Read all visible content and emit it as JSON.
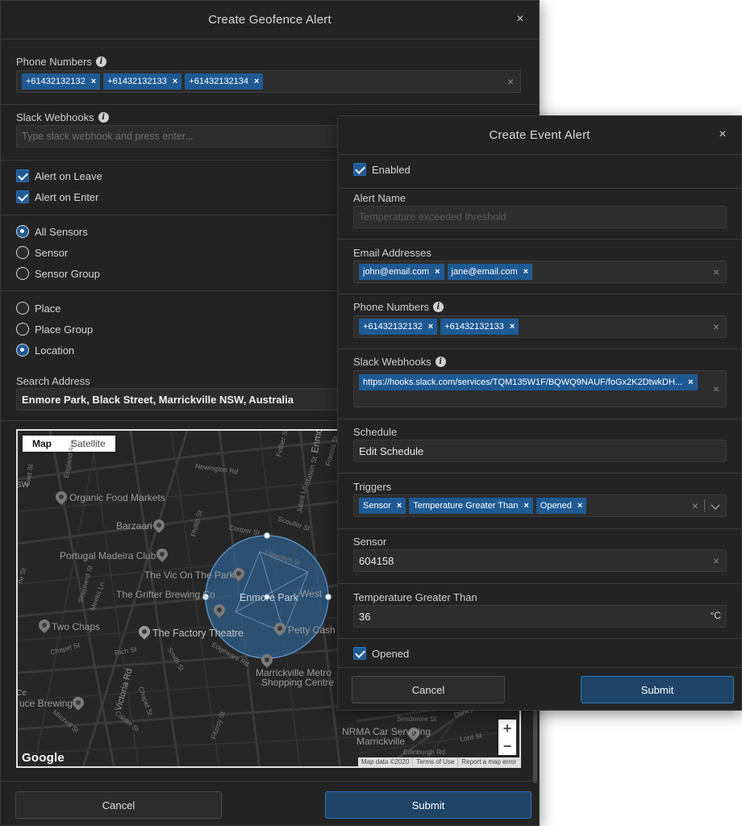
{
  "geofence": {
    "title": "Create Geofence Alert",
    "close": "×",
    "phone_label": "Phone Numbers",
    "phones": [
      "+61432132132",
      "+61432132133",
      "+61432132134"
    ],
    "slack_label": "Slack Webhooks",
    "slack_placeholder": "Type slack webhook and press enter...",
    "alert_leave": "Alert on Leave",
    "alert_enter": "Alert on Enter",
    "radio_all_sensors": "All Sensors",
    "radio_sensor": "Sensor",
    "radio_sensor_group": "Sensor Group",
    "radio_place": "Place",
    "radio_place_group": "Place Group",
    "radio_location": "Location",
    "search_label": "Search Address",
    "search_value": "Enmore Park, Black Street, Marrickville NSW, Australia",
    "cancel": "Cancel",
    "submit": "Submit"
  },
  "map": {
    "tab_map": "Map",
    "tab_satellite": "Satellite",
    "places": {
      "organic": "Organic Food Markets",
      "barzaari": "Barzaari",
      "madeira": "Portugal Madeira Club",
      "vic": "The Vic On The Park",
      "grifter": "The Grifter Brewing Co",
      "enmore": "Enmore Park",
      "west": "West",
      "two_chaps": "Two Chaps",
      "factory": "The Factory Theatre",
      "petty": "Petty Cash C",
      "metro1": "Marrickville Metro",
      "metro2": "Shopping Centre",
      "brewing": "uce Brewing",
      "nrma1": "NRMA Car Servicing",
      "nrma2": "Marrickville"
    },
    "streets": {
      "newington": "Newington Rd",
      "cooper": "Cooper St",
      "scouller": "Scouller St",
      "llewellyn": "Llewellyn St",
      "phillip": "Phillip St",
      "juliett": "Juliett Ln",
      "black": "Black St",
      "meeks": "Meeks Ln",
      "shepherd": "Shepherd St",
      "chapel": "Chapel St",
      "rich": "Rich St",
      "smith": "Smith St",
      "edgeware": "Edgeware Rd",
      "victoria": "Victoria Rd",
      "chapel2": "Chapel St",
      "calder": "Calder St",
      "fitzroy": "Fitzroy St",
      "mitchell": "Mitchell St",
      "edinburgh": "Edinburgh Rd",
      "lord": "Lord St",
      "smidmore": "Smidmore St",
      "darley": "Darley St",
      "east": "East St",
      "england": "England Ave",
      "festher": "Fether St",
      "francis": "Francis St",
      "station": "Station St",
      "charles": "Charles St",
      "sw": "SW",
      "ce": "Ce",
      "rle": "rle St",
      "st": "St",
      "enmo": "Enmo"
    },
    "zoom_in": "+",
    "zoom_out": "−",
    "google": "Google",
    "map_data": "Map data ©2020",
    "terms": "Terms of Use",
    "report": "Report a map error"
  },
  "event": {
    "title": "Create Event Alert",
    "close": "×",
    "enabled": "Enabled",
    "alert_name_label": "Alert Name",
    "alert_name_placeholder": "Temperature exceeded threshold",
    "email_label": "Email Addresses",
    "emails": [
      "john@email.com",
      "jane@email.com"
    ],
    "phone_label": "Phone Numbers",
    "phones": [
      "+61432132132",
      "+61432132133"
    ],
    "slack_label": "Slack Webhooks",
    "slack_chip": "https://hooks.slack.com/services/TQM135W1F/BQWQ9NAUF/foGx2K2DtwkDH...",
    "schedule_label": "Schedule",
    "schedule_value": "Edit Schedule",
    "triggers_label": "Triggers",
    "triggers": [
      "Sensor",
      "Temperature Greater Than",
      "Opened"
    ],
    "sensor_label": "Sensor",
    "sensor_value": "604158",
    "temp_label": "Temperature Greater Than",
    "temp_value": "36",
    "temp_unit": "°C",
    "opened": "Opened",
    "cancel": "Cancel",
    "submit": "Submit"
  }
}
